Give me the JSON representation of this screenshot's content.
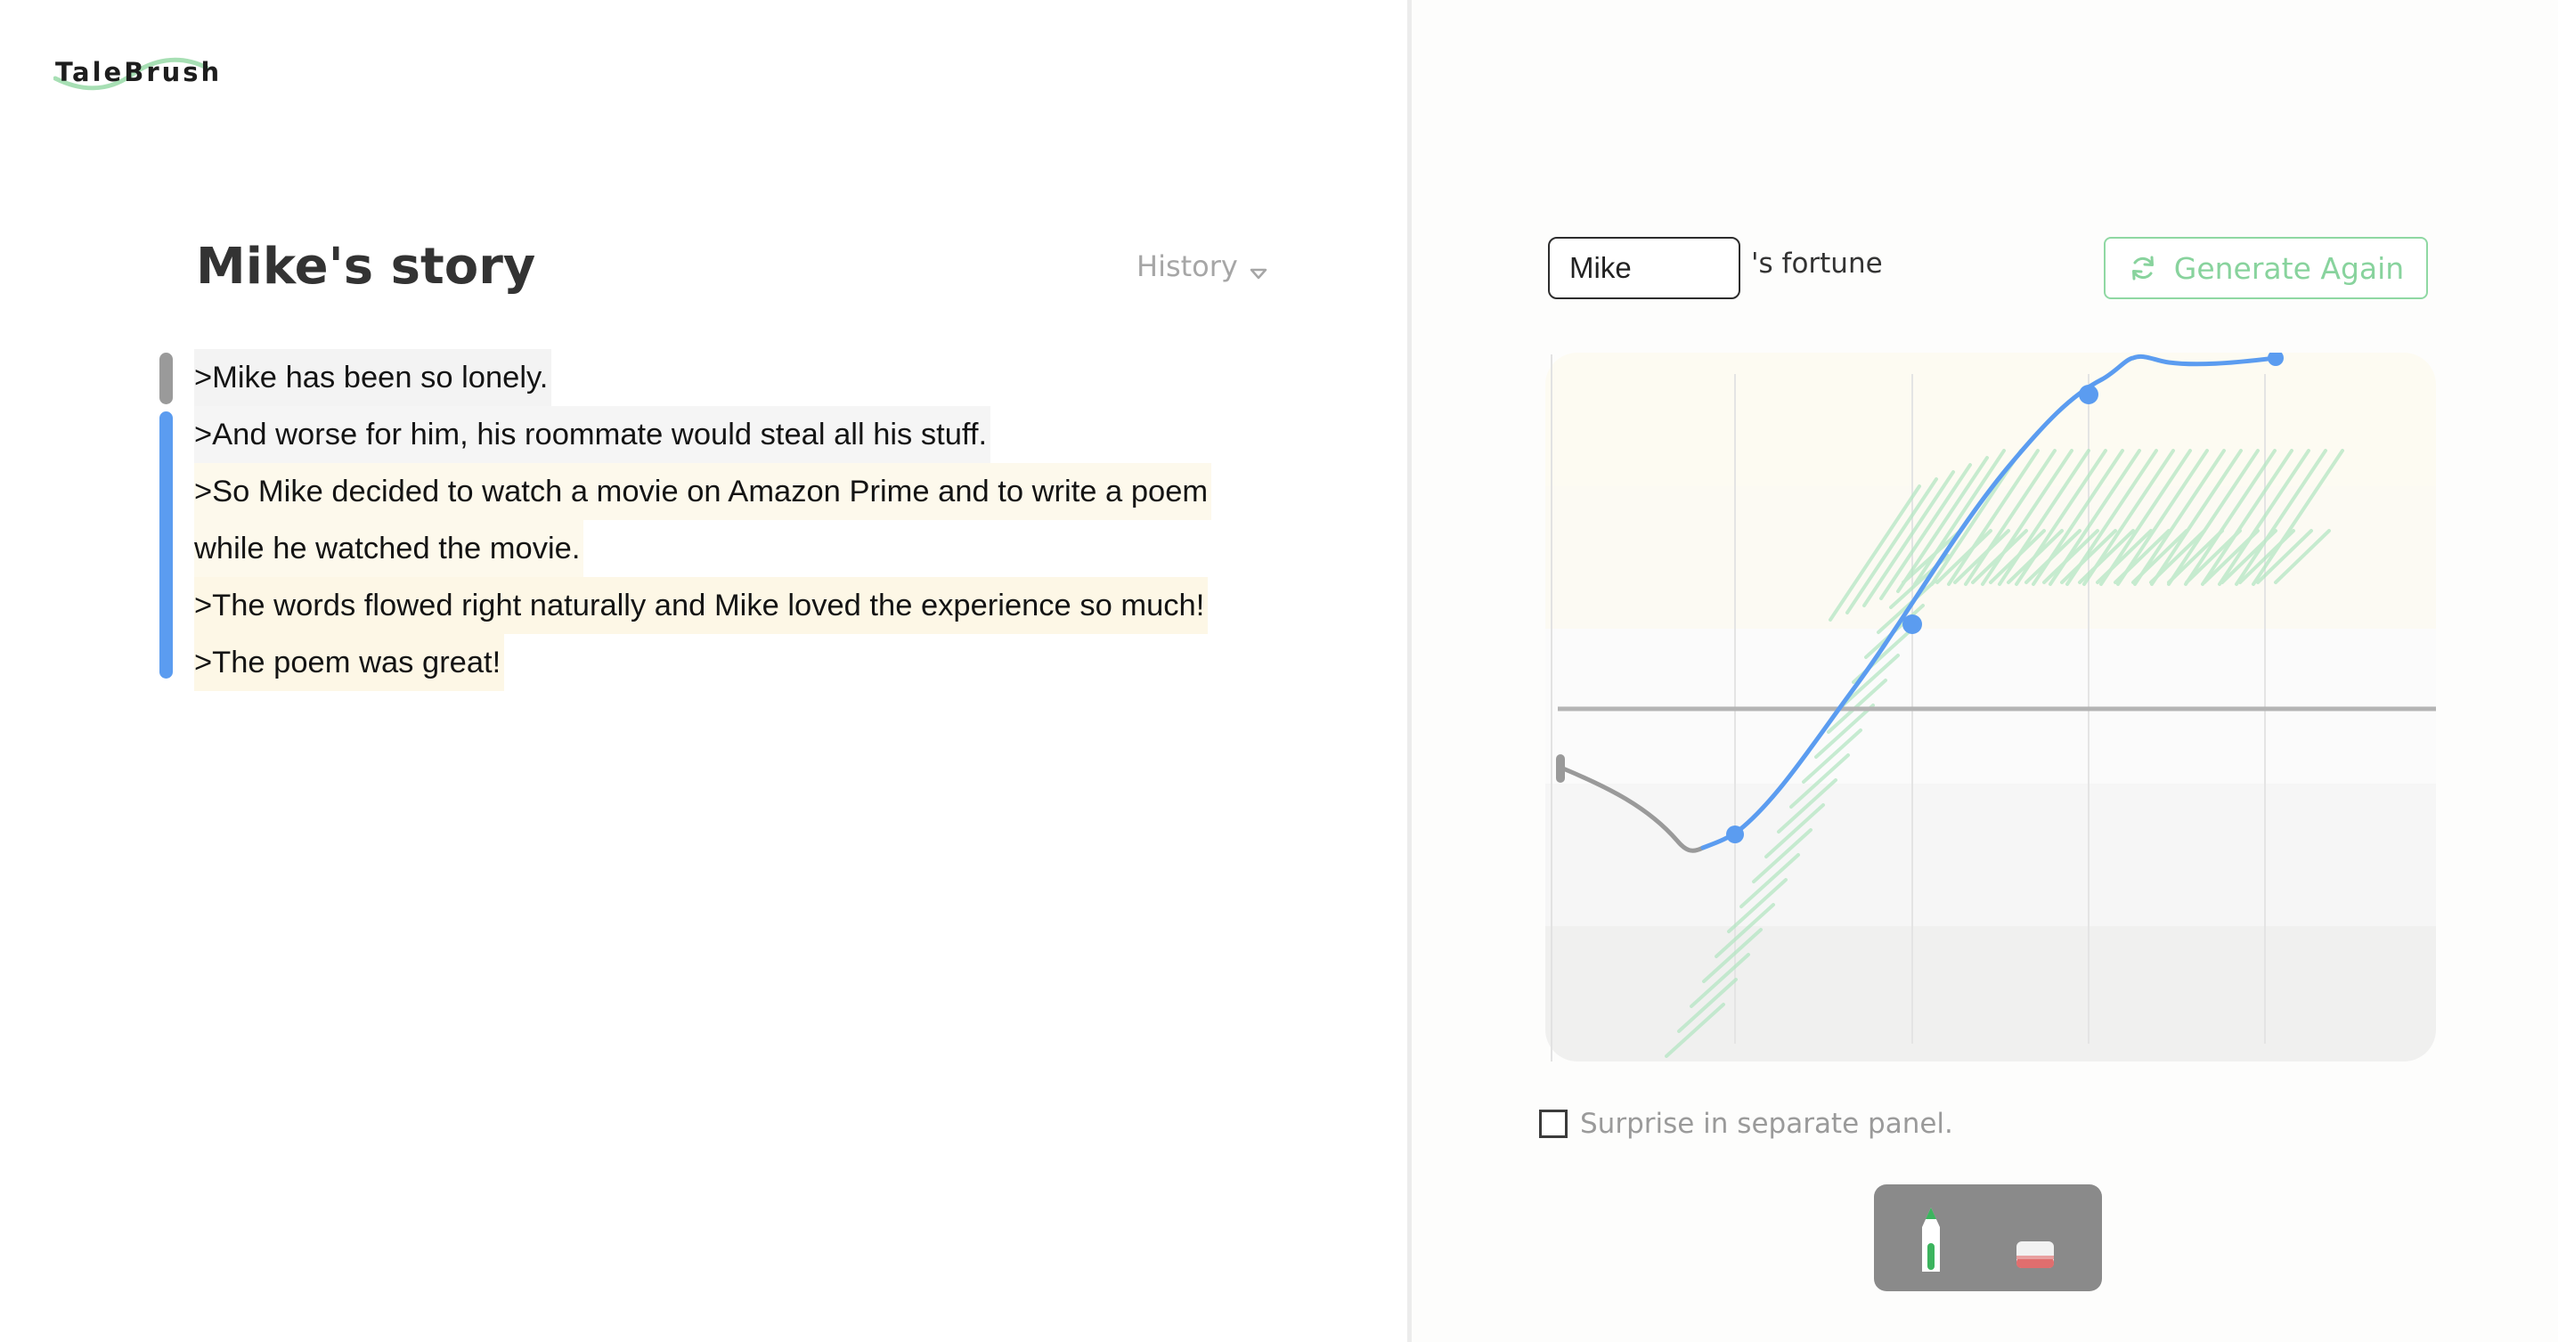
{
  "app": {
    "logo_text": "TaleBrush"
  },
  "story": {
    "title": "Mike's story",
    "history_label": "History",
    "history_icon": "chevron-down-icon",
    "lines": [
      ">Mike has been so lonely.",
      ">And worse for him, his roommate would steal all his stuff.",
      ">So Mike decided to watch a movie on Amazon Prime and to write a poem",
      "while he watched the movie.",
      ">The words flowed right naturally and Mike loved the experience so much!",
      ">The poem was great!"
    ]
  },
  "controls": {
    "character_name": "Mike",
    "fortune_suffix": "'s fortune",
    "generate_label": "Generate Again",
    "generate_icon": "refresh-icon",
    "surprise_label": "Surprise in separate panel.",
    "surprise_checked": false,
    "tools": [
      {
        "name": "pen-icon",
        "selected": true
      },
      {
        "name": "eraser-icon",
        "selected": false
      }
    ]
  },
  "colors": {
    "accent_green": "#88d39d",
    "curve_blue": "#5b9cf0",
    "curve_gray": "#9a9a9a",
    "sketch_green": "#b5e6c3"
  }
}
